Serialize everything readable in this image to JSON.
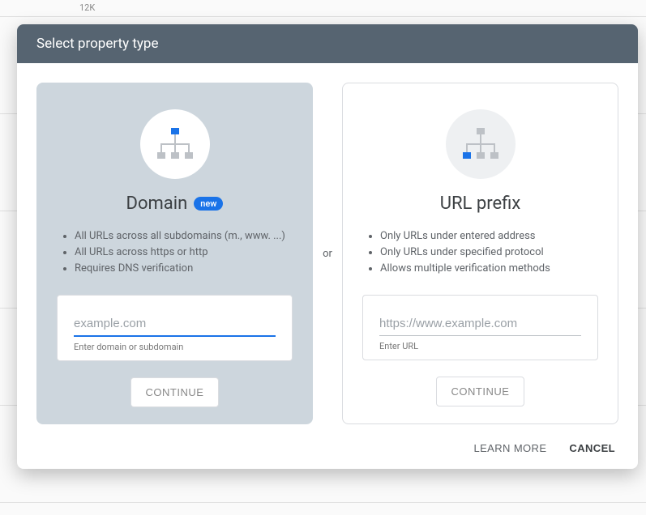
{
  "background": {
    "axis_label": "12K"
  },
  "dialog": {
    "title": "Select property type",
    "divider": "or",
    "footer": {
      "learn_more": "LEARN MORE",
      "cancel": "CANCEL"
    },
    "domain": {
      "title": "Domain",
      "badge": "new",
      "bullets": [
        "All URLs across all subdomains (m., www. ...)",
        "All URLs across https or http",
        "Requires DNS verification"
      ],
      "placeholder": "example.com",
      "helper": "Enter domain or subdomain",
      "continue": "CONTINUE"
    },
    "url_prefix": {
      "title": "URL prefix",
      "bullets": [
        "Only URLs under entered address",
        "Only URLs under specified protocol",
        "Allows multiple verification methods"
      ],
      "placeholder": "https://www.example.com",
      "helper": "Enter URL",
      "continue": "CONTINUE"
    }
  }
}
